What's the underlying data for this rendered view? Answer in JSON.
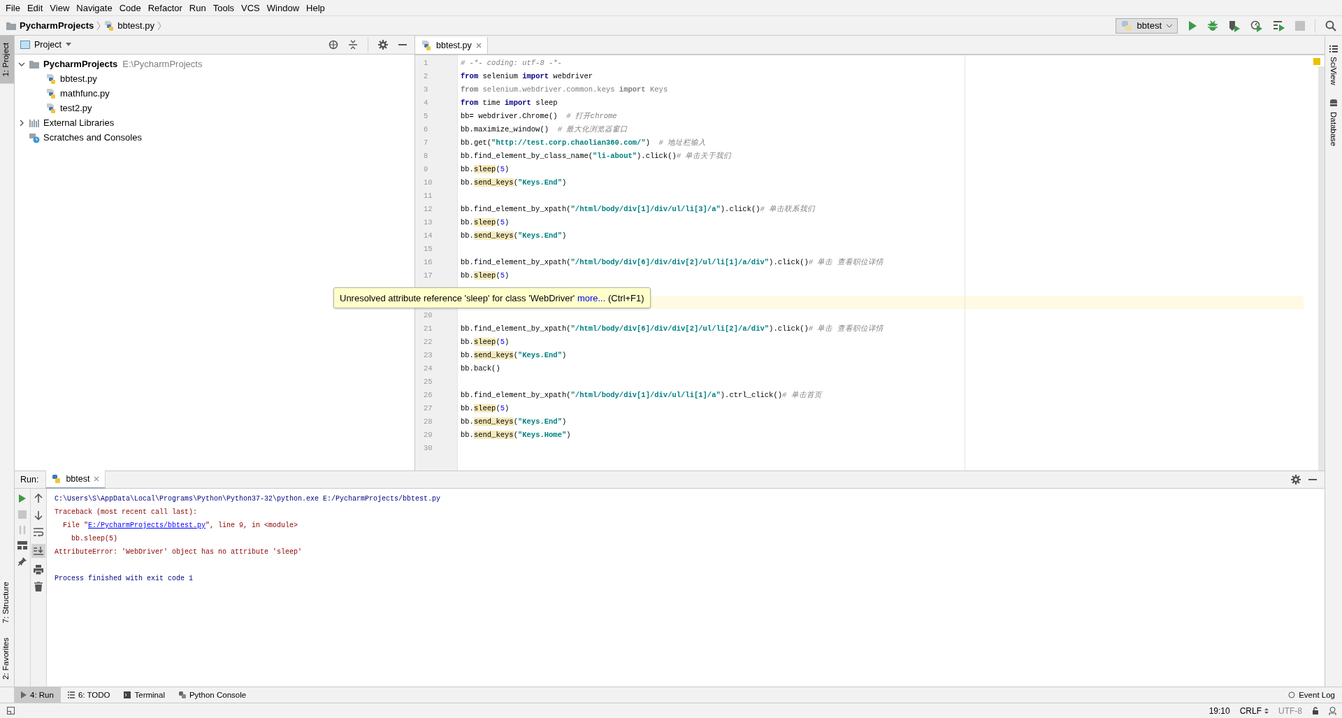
{
  "menu": [
    "File",
    "Edit",
    "View",
    "Navigate",
    "Code",
    "Refactor",
    "Run",
    "Tools",
    "VCS",
    "Window",
    "Help"
  ],
  "breadcrumbs": [
    {
      "kind": "folder",
      "label": "PycharmProjects"
    },
    {
      "kind": "file",
      "label": "bbtest.py"
    }
  ],
  "run_config": {
    "label": "bbtest",
    "stop_enabled": false
  },
  "left_tool_tabs_top": [
    {
      "label": "1: Project",
      "selected": true
    }
  ],
  "left_tool_tabs_bottom": [
    {
      "label": "7: Structure",
      "selected": false
    },
    {
      "label": "2: Favorites",
      "selected": false
    }
  ],
  "right_tool_tabs": [
    {
      "label": "SciView"
    },
    {
      "label": "Database"
    }
  ],
  "project_panel": {
    "title": "Project",
    "tree": [
      {
        "kind": "folder",
        "label": "PycharmProjects",
        "path": "E:\\PycharmProjects",
        "expanded": true,
        "children": [
          {
            "kind": "python",
            "label": "bbtest.py"
          },
          {
            "kind": "python",
            "label": "mathfunc.py"
          },
          {
            "kind": "python",
            "label": "test2.py"
          }
        ]
      },
      {
        "kind": "library",
        "label": "External Libraries",
        "expanded": false
      },
      {
        "kind": "scratches",
        "label": "Scratches and Consoles"
      }
    ]
  },
  "editor": {
    "tabs": [
      {
        "label": "bbtest.py",
        "selected": true
      }
    ],
    "lines": [
      {
        "number": "1",
        "current": false,
        "tokens": [
          {
            "kind": "comment",
            "text": "# -*- coding: utf-8 -*-"
          }
        ]
      },
      {
        "number": "2",
        "current": false,
        "tokens": [
          {
            "kind": "keyword",
            "text": "from"
          },
          {
            "kind": "plain",
            "text": " selenium "
          },
          {
            "kind": "keyword",
            "text": "import"
          },
          {
            "kind": "plain",
            "text": " webdriver"
          }
        ]
      },
      {
        "number": "3",
        "current": false,
        "tokens": [
          {
            "kind": "unused_keyword",
            "text": "from"
          },
          {
            "kind": "unused",
            "text": " selenium.webdriver.common.keys "
          },
          {
            "kind": "unused_keyword",
            "text": "import"
          },
          {
            "kind": "unused",
            "text": " Keys"
          }
        ]
      },
      {
        "number": "4",
        "current": false,
        "tokens": [
          {
            "kind": "keyword",
            "text": "from"
          },
          {
            "kind": "plain",
            "text": " time "
          },
          {
            "kind": "keyword",
            "text": "import"
          },
          {
            "kind": "plain",
            "text": " sleep"
          }
        ]
      },
      {
        "number": "5",
        "current": false,
        "tokens": [
          {
            "kind": "plain",
            "text": "bb= webdriver.Chrome()  "
          },
          {
            "kind": "comment",
            "text": "# 打开chrome"
          }
        ]
      },
      {
        "number": "6",
        "current": false,
        "tokens": [
          {
            "kind": "plain",
            "text": "bb.maximize_window()  "
          },
          {
            "kind": "comment",
            "text": "# 最大化浏览器窗口"
          }
        ]
      },
      {
        "number": "7",
        "current": false,
        "tokens": [
          {
            "kind": "plain",
            "text": "bb.get("
          },
          {
            "kind": "string",
            "text": "\"http://test.corp.chaolian360.com/\""
          },
          {
            "kind": "plain",
            "text": ")  "
          },
          {
            "kind": "comment",
            "text": "# 地址栏输入"
          }
        ]
      },
      {
        "number": "8",
        "current": false,
        "tokens": [
          {
            "kind": "plain",
            "text": "bb.find_element_by_class_name("
          },
          {
            "kind": "string",
            "text": "\"li-about\""
          },
          {
            "kind": "plain",
            "text": ").click()"
          },
          {
            "kind": "comment",
            "text": "# 单击关于我们"
          }
        ]
      },
      {
        "number": "9",
        "current": false,
        "tokens": [
          {
            "kind": "plain",
            "text": "bb."
          },
          {
            "kind": "unresolved",
            "text": "sleep"
          },
          {
            "kind": "plain",
            "text": "("
          },
          {
            "kind": "number",
            "text": "5"
          },
          {
            "kind": "plain",
            "text": ")"
          }
        ]
      },
      {
        "number": "10",
        "current": false,
        "tokens": [
          {
            "kind": "plain",
            "text": "bb."
          },
          {
            "kind": "unresolved",
            "text": "send_keys"
          },
          {
            "kind": "plain",
            "text": "("
          },
          {
            "kind": "string",
            "text": "\"Keys.End\""
          },
          {
            "kind": "plain",
            "text": ")"
          }
        ]
      },
      {
        "number": "11",
        "current": false
      },
      {
        "number": "12",
        "current": false,
        "tokens": [
          {
            "kind": "plain",
            "text": "bb.find_element_by_xpath("
          },
          {
            "kind": "string",
            "text": "\"/html/body/div[1]/div/ul/li[3]/a\""
          },
          {
            "kind": "plain",
            "text": ").click()"
          },
          {
            "kind": "comment",
            "text": "# 单击联系我们"
          }
        ]
      },
      {
        "number": "13",
        "current": false,
        "tokens": [
          {
            "kind": "plain",
            "text": "bb."
          },
          {
            "kind": "unresolved",
            "text": "sleep"
          },
          {
            "kind": "plain",
            "text": "("
          },
          {
            "kind": "number",
            "text": "5"
          },
          {
            "kind": "plain",
            "text": ")"
          }
        ]
      },
      {
        "number": "14",
        "current": false,
        "tokens": [
          {
            "kind": "plain",
            "text": "bb."
          },
          {
            "kind": "unresolved",
            "text": "send_keys"
          },
          {
            "kind": "plain",
            "text": "("
          },
          {
            "kind": "string",
            "text": "\"Keys.End\""
          },
          {
            "kind": "plain",
            "text": ")"
          }
        ]
      },
      {
        "number": "15",
        "current": false
      },
      {
        "number": "16",
        "current": false,
        "tokens": [
          {
            "kind": "plain",
            "text": "bb.find_element_by_xpath("
          },
          {
            "kind": "string",
            "text": "\"/html/body/div[6]/div/div[2]/ul/li[1]/a/div\""
          },
          {
            "kind": "plain",
            "text": ").click()"
          },
          {
            "kind": "comment",
            "text": "# 单击 查看职位详情"
          }
        ]
      },
      {
        "number": "17",
        "current": false,
        "tokens": [
          {
            "kind": "plain",
            "text": "bb."
          },
          {
            "kind": "unresolved",
            "text": "sleep"
          },
          {
            "kind": "plain",
            "text": "("
          },
          {
            "kind": "number",
            "text": "5"
          },
          {
            "kind": "plain",
            "text": ")"
          }
        ]
      },
      {
        "current": false
      },
      {
        "current": true
      },
      {
        "number": "20",
        "current": false
      },
      {
        "number": "21",
        "current": false,
        "tokens": [
          {
            "kind": "plain",
            "text": "bb.find_element_by_xpath("
          },
          {
            "kind": "string",
            "text": "\"/html/body/div[6]/div/div[2]/ul/li[2]/a/div\""
          },
          {
            "kind": "plain",
            "text": ").click()"
          },
          {
            "kind": "comment",
            "text": "# 单击 查看职位详情"
          }
        ]
      },
      {
        "number": "22",
        "current": false,
        "tokens": [
          {
            "kind": "plain",
            "text": "bb."
          },
          {
            "kind": "unresolved",
            "text": "sleep"
          },
          {
            "kind": "plain",
            "text": "("
          },
          {
            "kind": "number",
            "text": "5"
          },
          {
            "kind": "plain",
            "text": ")"
          }
        ]
      },
      {
        "number": "23",
        "current": false,
        "tokens": [
          {
            "kind": "plain",
            "text": "bb."
          },
          {
            "kind": "unresolved",
            "text": "send_keys"
          },
          {
            "kind": "plain",
            "text": "("
          },
          {
            "kind": "string",
            "text": "\"Keys.End\""
          },
          {
            "kind": "plain",
            "text": ")"
          }
        ]
      },
      {
        "number": "24",
        "current": false,
        "tokens": [
          {
            "kind": "plain",
            "text": "bb.back()"
          }
        ]
      },
      {
        "number": "25",
        "current": false
      },
      {
        "number": "26",
        "current": false,
        "tokens": [
          {
            "kind": "plain",
            "text": "bb.find_element_by_xpath("
          },
          {
            "kind": "string",
            "text": "\"/html/body/div[1]/div/ul/li[1]/a\""
          },
          {
            "kind": "plain",
            "text": ").ctrl_click()"
          },
          {
            "kind": "comment",
            "text": "# 单击首页"
          }
        ]
      },
      {
        "number": "27",
        "current": false,
        "tokens": [
          {
            "kind": "plain",
            "text": "bb."
          },
          {
            "kind": "unresolved",
            "text": "sleep"
          },
          {
            "kind": "plain",
            "text": "("
          },
          {
            "kind": "number",
            "text": "5"
          },
          {
            "kind": "plain",
            "text": ")"
          }
        ]
      },
      {
        "number": "28",
        "current": false,
        "tokens": [
          {
            "kind": "plain",
            "text": "bb."
          },
          {
            "kind": "unresolved",
            "text": "send_keys"
          },
          {
            "kind": "plain",
            "text": "("
          },
          {
            "kind": "string",
            "text": "\"Keys.End\""
          },
          {
            "kind": "plain",
            "text": ")"
          }
        ]
      },
      {
        "number": "29",
        "current": false,
        "tokens": [
          {
            "kind": "plain",
            "text": "bb."
          },
          {
            "kind": "unresolved",
            "text": "send_keys"
          },
          {
            "kind": "plain",
            "text": "("
          },
          {
            "kind": "string",
            "text": "\"Keys.Home\""
          },
          {
            "kind": "plain",
            "text": ")"
          }
        ]
      },
      {
        "number": "30",
        "current": false
      }
    ],
    "tooltip": {
      "message": "Unresolved attribute reference 'sleep' for class 'WebDriver'",
      "link": "more...",
      "shortcut": "(Ctrl+F1)"
    }
  },
  "run_panel": {
    "title": "Run:",
    "tabs": [
      {
        "label": "bbtest",
        "selected": true
      }
    ],
    "stop_enabled": false,
    "scroll_to_end": true,
    "console": [
      [
        {
          "kind": "command",
          "text": "C:\\Users\\S\\AppData\\Local\\Programs\\Python\\Python37-32\\python.exe E:/PycharmProjects/bbtest.py"
        }
      ],
      [
        {
          "kind": "error",
          "text": "Traceback (most recent call last):"
        }
      ],
      [
        {
          "kind": "error",
          "text": "  File \""
        },
        {
          "kind": "link",
          "text": "E:/PycharmProjects/bbtest.py"
        },
        {
          "kind": "error",
          "text": "\", line 9, in <module>"
        }
      ],
      [
        {
          "kind": "error",
          "text": "    bb.sleep(5)"
        }
      ],
      [
        {
          "kind": "error",
          "text": "AttributeError: 'WebDriver' object has no attribute 'sleep'"
        }
      ]
    ],
    "exit_message": "Process finished with exit code 1"
  },
  "bottom_tool_tabs": [
    {
      "label": "4: Run",
      "selected": true
    },
    {
      "label": "6: TODO",
      "selected": false
    },
    {
      "label": "Terminal",
      "selected": false
    },
    {
      "label": "Python Console",
      "selected": false
    }
  ],
  "event_log": "Event Log",
  "status_bar": {
    "position": "19:10",
    "line_separator": "CRLF",
    "encoding": "UTF-8"
  }
}
